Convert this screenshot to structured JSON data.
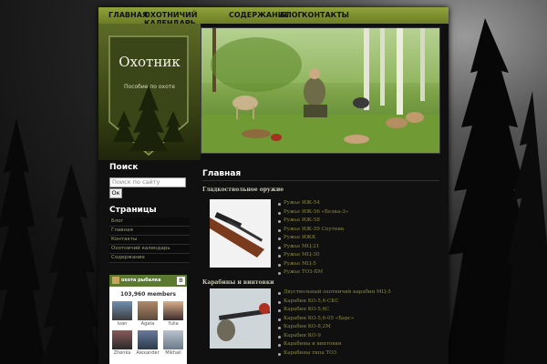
{
  "nav": {
    "items": [
      {
        "label": "ГЛАВНАЯ"
      },
      {
        "label": "ОХОТНИЧИЙ КАЛЕНДАРЬ"
      },
      {
        "label": "СОДЕРЖАНИЕ"
      },
      {
        "label": "БЛОГ"
      },
      {
        "label": "КОНТАКТЫ"
      }
    ]
  },
  "header": {
    "site_title": "Охотник",
    "tagline": "Пособие по охоте"
  },
  "sidebar": {
    "search_heading": "Поиск",
    "search_placeholder": "Поиск по сайту",
    "search_button": "Ок",
    "pages_heading": "Страницы",
    "pages": [
      {
        "label": "Блог"
      },
      {
        "label": "Главная"
      },
      {
        "label": "Контакты"
      },
      {
        "label": "Охотничий календарь"
      },
      {
        "label": "Содержание"
      }
    ],
    "vk_widget": {
      "group_name": "охота рыбалка",
      "members": "103,960 members",
      "people": [
        {
          "name": "Ivan"
        },
        {
          "name": "Agata"
        },
        {
          "name": "Yulia"
        },
        {
          "name": "Zhenka"
        },
        {
          "name": "Alexander"
        },
        {
          "name": "Mikhail"
        }
      ]
    }
  },
  "main": {
    "heading": "Главная",
    "sections": [
      {
        "title": "Гладкоствольное оружие",
        "items": [
          "Ружье ИЖ-54",
          "Ружье ИЖ-56 «Белка-3»",
          "Ружье ИЖ-58",
          "Ружье ИЖ-59 Спутник",
          "Ружье ИЖК",
          "Ружье МЦ-21",
          "Ружье МЦ-30",
          "Ружье МЦ-5",
          "Ружье ТОЗ-БМ"
        ]
      },
      {
        "title": "Карабины и винтовки",
        "items": [
          "Двуствольный охотничий карабин МЦ-5",
          "Карабин КО-5,6-СКС",
          "Карабин КО-5,6С",
          "Карабин КО-5,6-05 «Барс»",
          "Карабин КО-8,2М",
          "Карабин КО-9",
          "Карабины и винтовки",
          "Карабины типа ТОЗ"
        ]
      }
    ]
  },
  "colors": {
    "nav_green": "#7b8d2c",
    "link_olive": "#8c8a3a",
    "vk_green": "#5b7a2f"
  }
}
